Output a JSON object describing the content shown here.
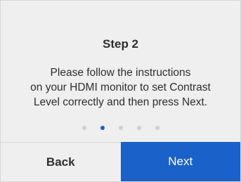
{
  "dialog": {
    "title": "Step 2",
    "instructions": "Please follow the instructions\non your HDMI monitor to set Contrast\nLevel correctly and then press Next."
  },
  "pager": {
    "total": 5,
    "current": 2,
    "active_color": "#1b5fc9",
    "inactive_color": "#cfcfcf"
  },
  "footer": {
    "back_label": "Back",
    "next_label": "Next",
    "next_color": "#1a61c9"
  }
}
